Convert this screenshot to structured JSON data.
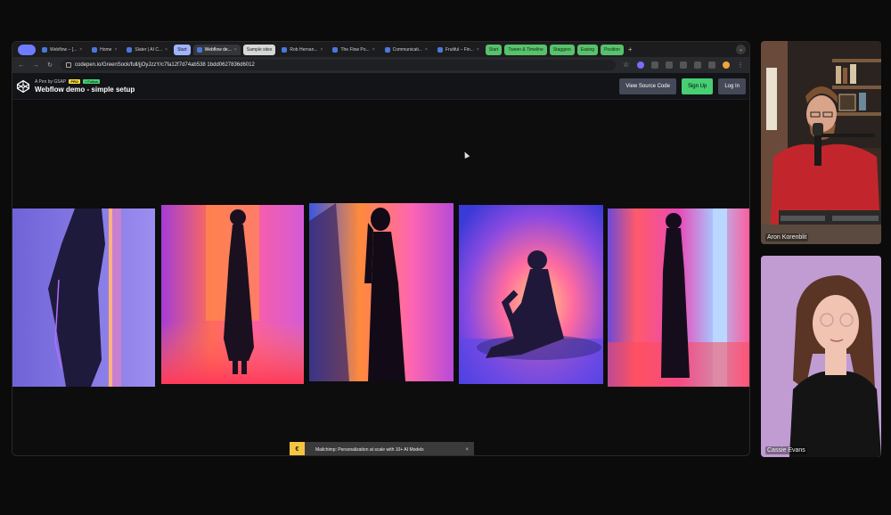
{
  "browser": {
    "tabs": [
      {
        "label": "",
        "kind": "pill"
      },
      {
        "label": "Webflow – [...",
        "kind": "normal"
      },
      {
        "label": "Home",
        "kind": "normal"
      },
      {
        "label": "Slater | AI C...",
        "kind": "normal"
      },
      {
        "label": "Start",
        "kind": "pill-blue"
      },
      {
        "label": "Webflow de...",
        "kind": "active"
      },
      {
        "label": "Sample sites",
        "kind": "pill-grey"
      },
      {
        "label": "Rob Hernan...",
        "kind": "normal"
      },
      {
        "label": "The Flow Po...",
        "kind": "normal"
      },
      {
        "label": "Communicati...",
        "kind": "normal"
      },
      {
        "label": "Fruitful – Fin...",
        "kind": "normal"
      },
      {
        "label": "Start",
        "kind": "pill-green"
      },
      {
        "label": "Tween & Timeline",
        "kind": "pill-green"
      },
      {
        "label": "Staggers",
        "kind": "pill-green"
      },
      {
        "label": "Easing",
        "kind": "pill-green"
      },
      {
        "label": "Position",
        "kind": "pill-green"
      }
    ],
    "url": "codepen.io/GreenSock/full/jjOyJzzY/c7fa12f7d74ab538 1bdd0627836d6012"
  },
  "codepen": {
    "byline": "A Pen by GSAP",
    "pro_badge": "PRO",
    "follow_badge": "+ Follow",
    "title": "Webflow demo - simple setup",
    "view_source": "View Source Code",
    "sign_up": "Sign Up",
    "log_in": "Log In"
  },
  "ad": {
    "icon": "mailchimp-icon",
    "text": "Mailchimp: Personalization at scale with 10+ AI Models",
    "close": "×"
  },
  "webcams": [
    {
      "name": "Aron Korenblit"
    },
    {
      "name": "Cassie Evans"
    }
  ],
  "colors": {
    "accent_green": "#47cf73",
    "codepen_dark": "#131417",
    "button_grey": "#444857"
  }
}
